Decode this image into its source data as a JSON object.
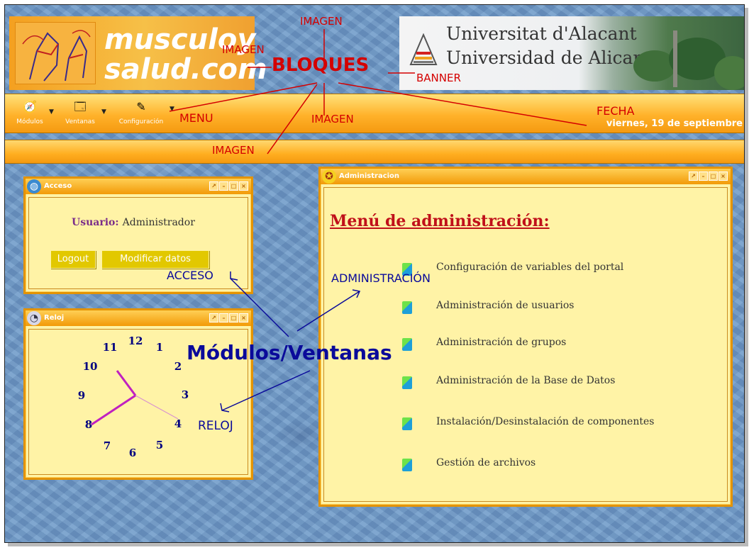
{
  "header": {
    "logo_line1": "musculoy",
    "logo_line2": "salud.com",
    "university_line1": "Universitat d'Alacant",
    "university_line2": "Universidad de Alicante"
  },
  "menu": {
    "items": [
      {
        "label": "Módulos",
        "icon": "modules-icon"
      },
      {
        "label": "Ventanas",
        "icon": "windows-icon"
      },
      {
        "label": "Configuración",
        "icon": "config-icon"
      }
    ],
    "date": "viernes, 19 de septiembre"
  },
  "windows": {
    "acceso": {
      "title": "Acceso",
      "user_label": "Usuario:",
      "user_value": "Administrador",
      "logout_label": "Logout",
      "modify_label": "Modificar datos"
    },
    "reloj": {
      "title": "Reloj",
      "numbers": [
        "12",
        "1",
        "2",
        "3",
        "4",
        "5",
        "6",
        "7",
        "8",
        "9",
        "10",
        "11"
      ]
    },
    "admin": {
      "title": "Administracion",
      "heading": "Menú de administración:",
      "items": [
        "Configuración de variables del portal",
        "Administración de usuarios",
        "Administración de grupos",
        "Administración de la Base de Datos",
        "Instalación/Desinstalación de componentes",
        "Gestión de archivos"
      ]
    }
  },
  "annotations": {
    "imagen": "IMAGEN",
    "bloques": "BLOQUES",
    "banner": "BANNER",
    "menu": "MENU",
    "fecha": "FECHA",
    "acceso": "ACCESO",
    "administracion": "ADMINISTRACIÓN",
    "modulos_ventanas": "Módulos/Ventanas",
    "reloj": "RELOJ"
  },
  "colors": {
    "accent_orange": "#f29a08",
    "annotation_red": "#d40000",
    "annotation_blue": "#0a0a9a",
    "window_bg": "#fff3a6"
  }
}
